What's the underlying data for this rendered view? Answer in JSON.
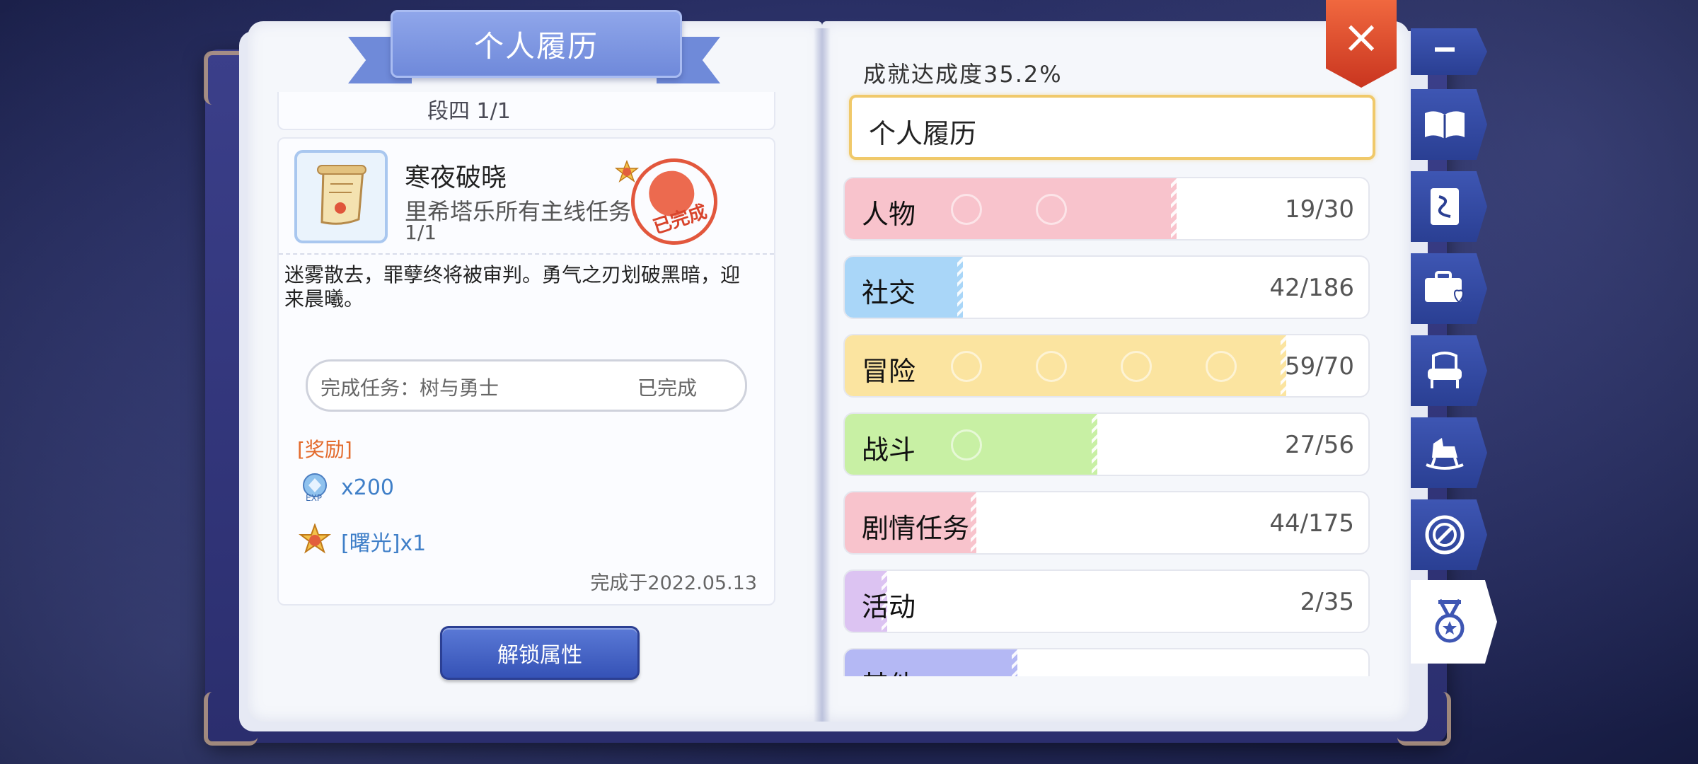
{
  "title": "个人履历",
  "left_page": {
    "prev_card_text": "段四 1/1",
    "quest": {
      "title": "寒夜破晓",
      "description": "里希塔乐所有主线任务",
      "progress": "1/1",
      "stamp": "已完成",
      "flavor": "迷雾散去，罪孽终将被审判。勇气之刃划破黑暗，迎来晨曦。",
      "task_name": "完成任务：树与勇士",
      "task_status": "已完成",
      "reward_header": "[奖励]",
      "rewards": [
        {
          "icon": "exp-orb-icon",
          "label": "x200"
        },
        {
          "icon": "medal-icon",
          "label": "[曙光]x1"
        }
      ],
      "completed_date": "完成于2022.05.13"
    },
    "unlock_button": "解锁属性"
  },
  "right_page": {
    "achievement_rate": "成就达成度35.2%",
    "selected_category": "个人履历",
    "categories": [
      {
        "label": "人物",
        "count": "19/30",
        "progress": 0.6333,
        "color": "#f8c3cc"
      },
      {
        "label": "社交",
        "count": "42/186",
        "progress": 0.2258,
        "color": "#a9d6f8"
      },
      {
        "label": "冒险",
        "count": "59/70",
        "progress": 0.8429,
        "color": "#fbe4a0"
      },
      {
        "label": "战斗",
        "count": "27/56",
        "progress": 0.4821,
        "color": "#c8f0a4"
      },
      {
        "label": "剧情任务",
        "count": "44/175",
        "progress": 0.2514,
        "color": "#f8c3cc"
      },
      {
        "label": "活动",
        "count": "2/35",
        "progress": 0.0571,
        "color": "#dcc3f2"
      },
      {
        "label": "其他",
        "count": "",
        "progress": 0.33,
        "color": "#b4b8f4"
      }
    ]
  },
  "close_button": "×",
  "side_tabs": [
    "bookmark-icon",
    "book-icon",
    "card-icon",
    "briefcase-heart-icon",
    "armchair-icon",
    "rocking-horse-icon",
    "badge-icon",
    "medal-ribbon-icon"
  ]
}
